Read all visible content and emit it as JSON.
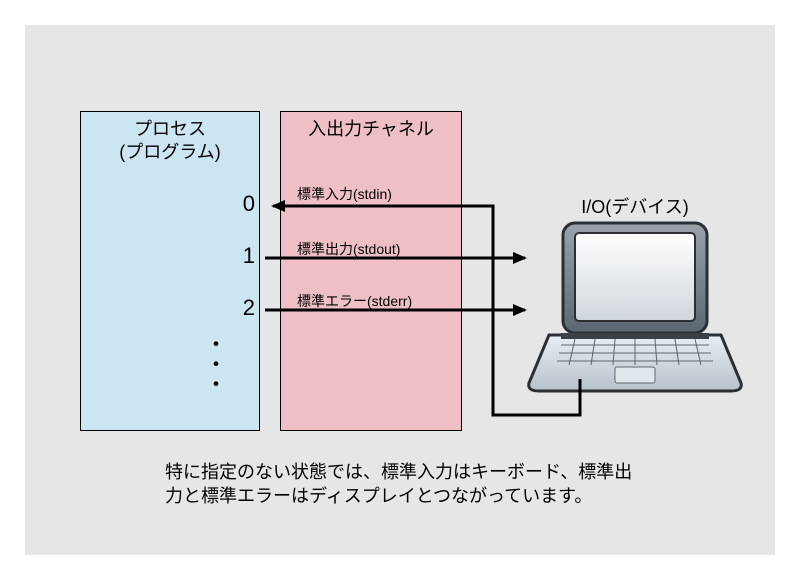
{
  "process": {
    "title_line1": "プロセス",
    "title_line2": "(プログラム)",
    "fd0": "0",
    "fd1": "1",
    "fd2": "2",
    "dots": "・\n・\n・"
  },
  "channel": {
    "title": "入出力チャネル",
    "stdin": "標準入力(stdin)",
    "stdout": "標準出力(stdout)",
    "stderr": "標準エラー(stderr)"
  },
  "io": {
    "title": "I/O(デバイス)"
  },
  "caption": "特に指定のない状態では、標準入力はキーボード、標準出力と標準エラーはディスプレイとつながっています。"
}
